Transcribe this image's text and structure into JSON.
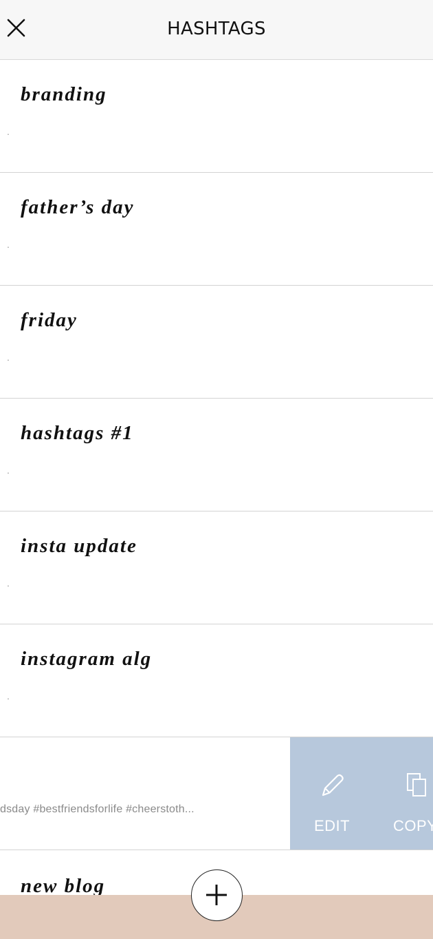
{
  "header": {
    "title": "HASHTAGS",
    "close_icon": "close-icon"
  },
  "lists": [
    {
      "title": "branding",
      "subtitle": "."
    },
    {
      "title": "father’s day",
      "subtitle": "."
    },
    {
      "title": "friday",
      "subtitle": "."
    },
    {
      "title": "hashtags #1",
      "subtitle": "."
    },
    {
      "title": "insta update",
      "subtitle": "."
    },
    {
      "title": "instagram alg",
      "subtitle": "."
    }
  ],
  "swiped_row": {
    "subtitle": "dsday #bestfriendsforlife #cheerstoth...",
    "actions": {
      "edit_label": "EDIT",
      "copy_label": "COPY",
      "edit_icon": "pencil-icon",
      "copy_icon": "copy-icon",
      "background_color": "#b7c8dc"
    }
  },
  "partial_row": {
    "title": "new blog"
  },
  "footer": {
    "add_icon": "plus-icon",
    "bar_color": "#e2cabb"
  }
}
